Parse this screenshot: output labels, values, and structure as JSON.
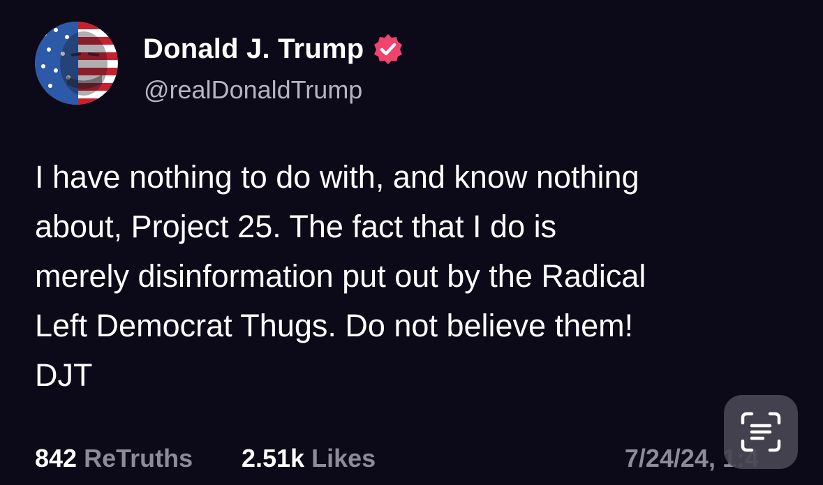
{
  "author": {
    "display_name": "Donald J. Trump",
    "handle": "@realDonaldTrump",
    "avatar_icon": "flag-portrait-avatar",
    "verified_icon": "verified-badge-icon",
    "verified_color": "#f0436e"
  },
  "post": {
    "lines": [
      "I have nothing to do with, and know nothing",
      "about, Project 25. The fact that I do is",
      "merely disinformation put out by the Radical",
      "Left Democrat Thugs. Do not believe them!",
      "DJT"
    ]
  },
  "stats": {
    "retruths_count": "842",
    "retruths_label": "ReTruths",
    "likes_count": "2.51k",
    "likes_label": "Likes"
  },
  "timestamp": "7/24/24, 1:4",
  "overlay": {
    "icon": "live-text-scan-icon"
  },
  "colors": {
    "background": "#0c0918",
    "text": "#ffffff",
    "muted": "#8e8b99",
    "handle": "#b7b4c2"
  }
}
